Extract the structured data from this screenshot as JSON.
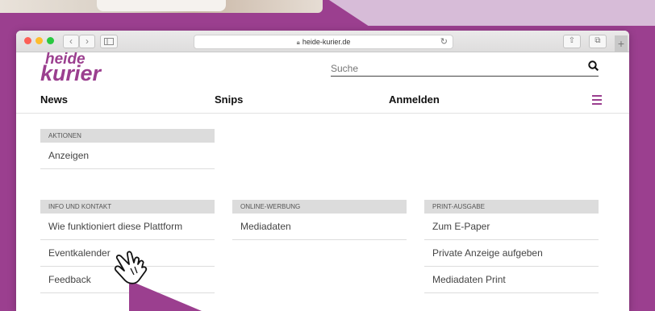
{
  "browser": {
    "url": "heide-kurier.de",
    "back": "‹",
    "forward": "›"
  },
  "brand": {
    "line1": "heide",
    "line2": "kurier",
    "color": "#9b3f8f"
  },
  "search": {
    "placeholder": "Suche",
    "icon": "search-icon"
  },
  "nav": {
    "items": [
      "News",
      "Snips",
      "Anmelden"
    ],
    "menu_icon": "hamburger-icon"
  },
  "sections": {
    "aktionen": {
      "title": "AKTIONEN",
      "items": [
        "Anzeigen"
      ]
    },
    "info": {
      "title": "INFO UND KONTAKT",
      "items": [
        "Wie funktioniert diese Plattform",
        "Eventkalender",
        "Feedback"
      ]
    },
    "online": {
      "title": "ONLINE-WERBUNG",
      "items": [
        "Mediadaten"
      ]
    },
    "print": {
      "title": "PRINT-AUSGABE",
      "items": [
        "Zum E-Paper",
        "Private Anzeige aufgeben",
        "Mediadaten Print"
      ]
    }
  }
}
